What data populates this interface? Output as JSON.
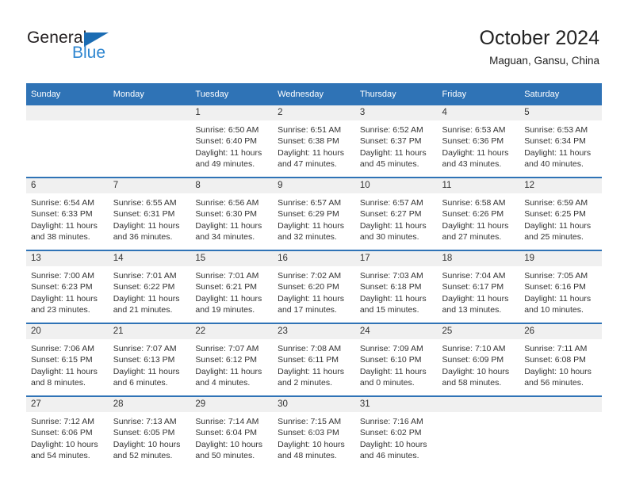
{
  "brand": {
    "name_part1": "General",
    "name_part2": "Blue",
    "accent_color": "#2e86d0",
    "triangle_color": "#1b6cb3"
  },
  "header": {
    "title": "October 2024",
    "subtitle": "Maguan, Gansu, China"
  },
  "theme": {
    "header_blue": "#2f73b6",
    "daynum_band": "#f0f0f0",
    "text": "#333333"
  },
  "weekday_headers": [
    "Sunday",
    "Monday",
    "Tuesday",
    "Wednesday",
    "Thursday",
    "Friday",
    "Saturday"
  ],
  "weeks": [
    [
      {
        "day": "",
        "blank": true,
        "sunrise": "",
        "sunset": "",
        "daylight1": "",
        "daylight2": ""
      },
      {
        "day": "",
        "blank": true,
        "sunrise": "",
        "sunset": "",
        "daylight1": "",
        "daylight2": ""
      },
      {
        "day": "1",
        "blank": false,
        "sunrise": "Sunrise: 6:50 AM",
        "sunset": "Sunset: 6:40 PM",
        "daylight1": "Daylight: 11 hours",
        "daylight2": "and 49 minutes."
      },
      {
        "day": "2",
        "blank": false,
        "sunrise": "Sunrise: 6:51 AM",
        "sunset": "Sunset: 6:38 PM",
        "daylight1": "Daylight: 11 hours",
        "daylight2": "and 47 minutes."
      },
      {
        "day": "3",
        "blank": false,
        "sunrise": "Sunrise: 6:52 AM",
        "sunset": "Sunset: 6:37 PM",
        "daylight1": "Daylight: 11 hours",
        "daylight2": "and 45 minutes."
      },
      {
        "day": "4",
        "blank": false,
        "sunrise": "Sunrise: 6:53 AM",
        "sunset": "Sunset: 6:36 PM",
        "daylight1": "Daylight: 11 hours",
        "daylight2": "and 43 minutes."
      },
      {
        "day": "5",
        "blank": false,
        "sunrise": "Sunrise: 6:53 AM",
        "sunset": "Sunset: 6:34 PM",
        "daylight1": "Daylight: 11 hours",
        "daylight2": "and 40 minutes."
      }
    ],
    [
      {
        "day": "6",
        "blank": false,
        "sunrise": "Sunrise: 6:54 AM",
        "sunset": "Sunset: 6:33 PM",
        "daylight1": "Daylight: 11 hours",
        "daylight2": "and 38 minutes."
      },
      {
        "day": "7",
        "blank": false,
        "sunrise": "Sunrise: 6:55 AM",
        "sunset": "Sunset: 6:31 PM",
        "daylight1": "Daylight: 11 hours",
        "daylight2": "and 36 minutes."
      },
      {
        "day": "8",
        "blank": false,
        "sunrise": "Sunrise: 6:56 AM",
        "sunset": "Sunset: 6:30 PM",
        "daylight1": "Daylight: 11 hours",
        "daylight2": "and 34 minutes."
      },
      {
        "day": "9",
        "blank": false,
        "sunrise": "Sunrise: 6:57 AM",
        "sunset": "Sunset: 6:29 PM",
        "daylight1": "Daylight: 11 hours",
        "daylight2": "and 32 minutes."
      },
      {
        "day": "10",
        "blank": false,
        "sunrise": "Sunrise: 6:57 AM",
        "sunset": "Sunset: 6:27 PM",
        "daylight1": "Daylight: 11 hours",
        "daylight2": "and 30 minutes."
      },
      {
        "day": "11",
        "blank": false,
        "sunrise": "Sunrise: 6:58 AM",
        "sunset": "Sunset: 6:26 PM",
        "daylight1": "Daylight: 11 hours",
        "daylight2": "and 27 minutes."
      },
      {
        "day": "12",
        "blank": false,
        "sunrise": "Sunrise: 6:59 AM",
        "sunset": "Sunset: 6:25 PM",
        "daylight1": "Daylight: 11 hours",
        "daylight2": "and 25 minutes."
      }
    ],
    [
      {
        "day": "13",
        "blank": false,
        "sunrise": "Sunrise: 7:00 AM",
        "sunset": "Sunset: 6:23 PM",
        "daylight1": "Daylight: 11 hours",
        "daylight2": "and 23 minutes."
      },
      {
        "day": "14",
        "blank": false,
        "sunrise": "Sunrise: 7:01 AM",
        "sunset": "Sunset: 6:22 PM",
        "daylight1": "Daylight: 11 hours",
        "daylight2": "and 21 minutes."
      },
      {
        "day": "15",
        "blank": false,
        "sunrise": "Sunrise: 7:01 AM",
        "sunset": "Sunset: 6:21 PM",
        "daylight1": "Daylight: 11 hours",
        "daylight2": "and 19 minutes."
      },
      {
        "day": "16",
        "blank": false,
        "sunrise": "Sunrise: 7:02 AM",
        "sunset": "Sunset: 6:20 PM",
        "daylight1": "Daylight: 11 hours",
        "daylight2": "and 17 minutes."
      },
      {
        "day": "17",
        "blank": false,
        "sunrise": "Sunrise: 7:03 AM",
        "sunset": "Sunset: 6:18 PM",
        "daylight1": "Daylight: 11 hours",
        "daylight2": "and 15 minutes."
      },
      {
        "day": "18",
        "blank": false,
        "sunrise": "Sunrise: 7:04 AM",
        "sunset": "Sunset: 6:17 PM",
        "daylight1": "Daylight: 11 hours",
        "daylight2": "and 13 minutes."
      },
      {
        "day": "19",
        "blank": false,
        "sunrise": "Sunrise: 7:05 AM",
        "sunset": "Sunset: 6:16 PM",
        "daylight1": "Daylight: 11 hours",
        "daylight2": "and 10 minutes."
      }
    ],
    [
      {
        "day": "20",
        "blank": false,
        "sunrise": "Sunrise: 7:06 AM",
        "sunset": "Sunset: 6:15 PM",
        "daylight1": "Daylight: 11 hours",
        "daylight2": "and 8 minutes."
      },
      {
        "day": "21",
        "blank": false,
        "sunrise": "Sunrise: 7:07 AM",
        "sunset": "Sunset: 6:13 PM",
        "daylight1": "Daylight: 11 hours",
        "daylight2": "and 6 minutes."
      },
      {
        "day": "22",
        "blank": false,
        "sunrise": "Sunrise: 7:07 AM",
        "sunset": "Sunset: 6:12 PM",
        "daylight1": "Daylight: 11 hours",
        "daylight2": "and 4 minutes."
      },
      {
        "day": "23",
        "blank": false,
        "sunrise": "Sunrise: 7:08 AM",
        "sunset": "Sunset: 6:11 PM",
        "daylight1": "Daylight: 11 hours",
        "daylight2": "and 2 minutes."
      },
      {
        "day": "24",
        "blank": false,
        "sunrise": "Sunrise: 7:09 AM",
        "sunset": "Sunset: 6:10 PM",
        "daylight1": "Daylight: 11 hours",
        "daylight2": "and 0 minutes."
      },
      {
        "day": "25",
        "blank": false,
        "sunrise": "Sunrise: 7:10 AM",
        "sunset": "Sunset: 6:09 PM",
        "daylight1": "Daylight: 10 hours",
        "daylight2": "and 58 minutes."
      },
      {
        "day": "26",
        "blank": false,
        "sunrise": "Sunrise: 7:11 AM",
        "sunset": "Sunset: 6:08 PM",
        "daylight1": "Daylight: 10 hours",
        "daylight2": "and 56 minutes."
      }
    ],
    [
      {
        "day": "27",
        "blank": false,
        "sunrise": "Sunrise: 7:12 AM",
        "sunset": "Sunset: 6:06 PM",
        "daylight1": "Daylight: 10 hours",
        "daylight2": "and 54 minutes."
      },
      {
        "day": "28",
        "blank": false,
        "sunrise": "Sunrise: 7:13 AM",
        "sunset": "Sunset: 6:05 PM",
        "daylight1": "Daylight: 10 hours",
        "daylight2": "and 52 minutes."
      },
      {
        "day": "29",
        "blank": false,
        "sunrise": "Sunrise: 7:14 AM",
        "sunset": "Sunset: 6:04 PM",
        "daylight1": "Daylight: 10 hours",
        "daylight2": "and 50 minutes."
      },
      {
        "day": "30",
        "blank": false,
        "sunrise": "Sunrise: 7:15 AM",
        "sunset": "Sunset: 6:03 PM",
        "daylight1": "Daylight: 10 hours",
        "daylight2": "and 48 minutes."
      },
      {
        "day": "31",
        "blank": false,
        "sunrise": "Sunrise: 7:16 AM",
        "sunset": "Sunset: 6:02 PM",
        "daylight1": "Daylight: 10 hours",
        "daylight2": "and 46 minutes."
      },
      {
        "day": "",
        "blank": true,
        "sunrise": "",
        "sunset": "",
        "daylight1": "",
        "daylight2": ""
      },
      {
        "day": "",
        "blank": true,
        "sunrise": "",
        "sunset": "",
        "daylight1": "",
        "daylight2": ""
      }
    ]
  ]
}
